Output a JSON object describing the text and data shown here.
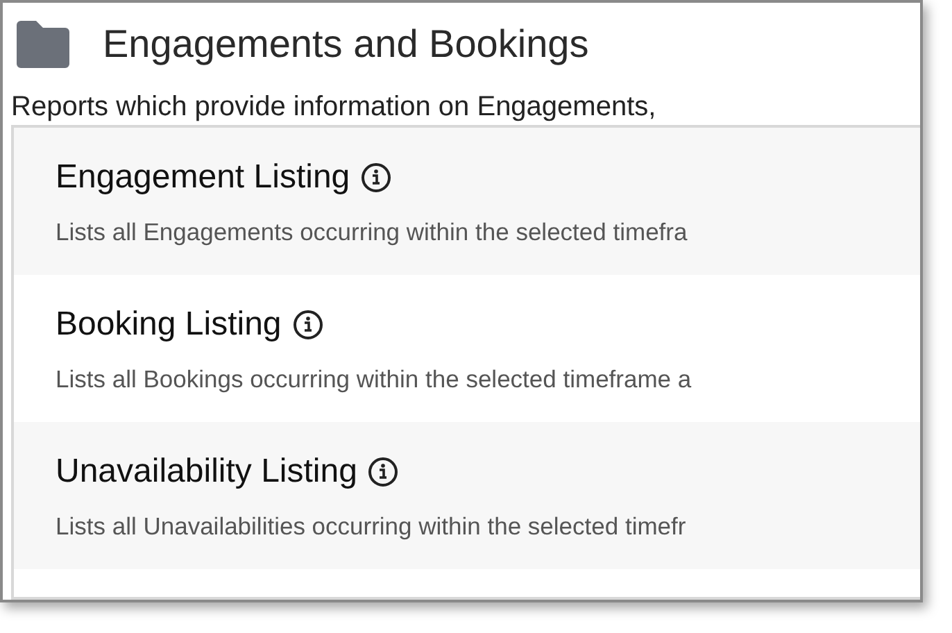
{
  "header": {
    "title": "Engagements and Bookings",
    "description": "Reports which provide information on Engagements,"
  },
  "reports": [
    {
      "title": "Engagement Listing",
      "description": "Lists all Engagements occurring within the selected timefra"
    },
    {
      "title": "Booking Listing",
      "description": "Lists all Bookings occurring within the selected timeframe a"
    },
    {
      "title": "Unavailability Listing",
      "description": "Lists all Unavailabilities occurring within the selected timefr"
    }
  ]
}
